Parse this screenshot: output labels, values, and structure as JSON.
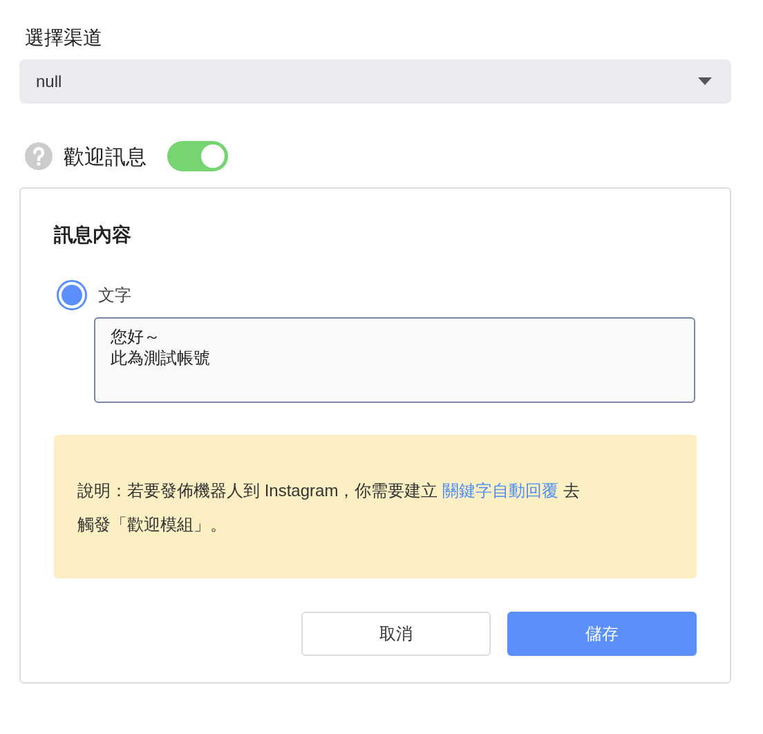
{
  "channel": {
    "label": "選擇渠道",
    "value": "null"
  },
  "welcome": {
    "label": "歡迎訊息",
    "on": true
  },
  "content": {
    "title": "訊息內容",
    "options": [
      {
        "label": "文字",
        "selected": true
      }
    ],
    "text_lines": [
      "您好～",
      "此為測試帳號"
    ]
  },
  "note": {
    "before": "說明：若要發佈機器人到 Instagram，你需要建立 ",
    "link": "關鍵字自動回覆",
    "after": " 去觸發「歡迎模組」。"
  },
  "buttons": [
    {
      "label": "取消",
      "kind": "secondary"
    },
    {
      "label": "儲存",
      "kind": "primary"
    }
  ]
}
